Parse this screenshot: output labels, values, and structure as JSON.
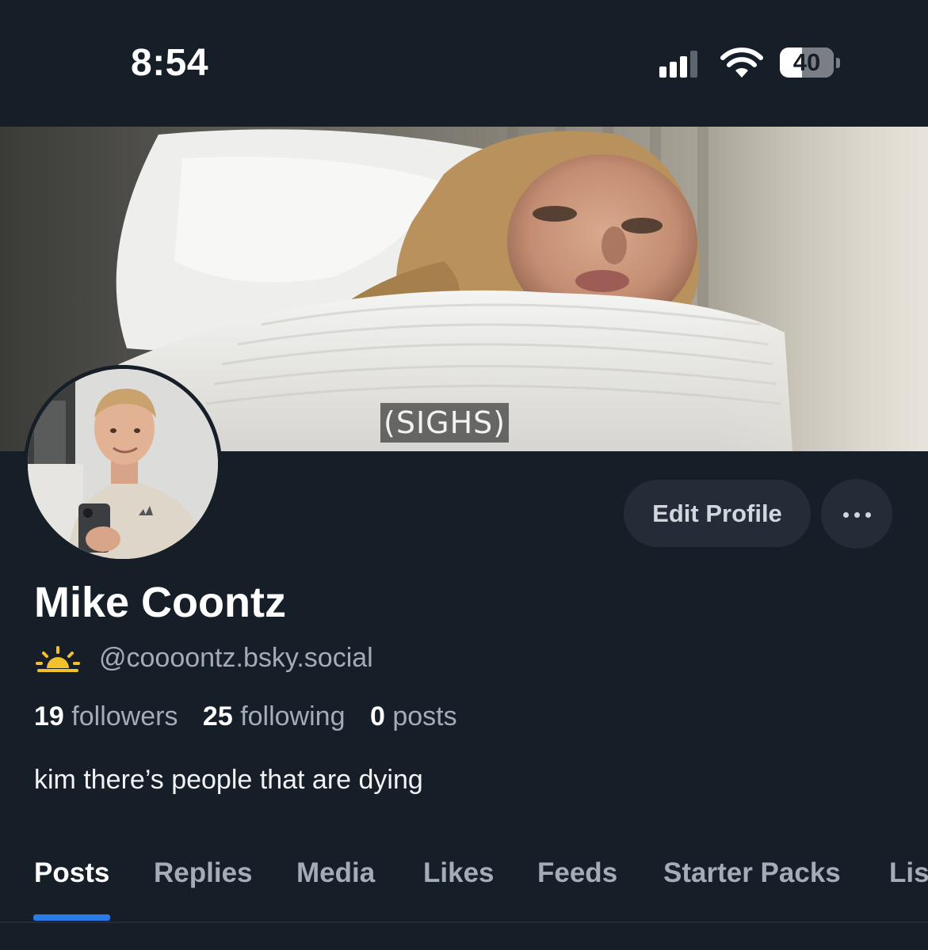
{
  "status_bar": {
    "time": "8:54",
    "battery_level": "40",
    "signal_bars_filled": 3,
    "signal_bars_total": 4
  },
  "banner": {
    "caption": "(SIGHS)"
  },
  "actions": {
    "edit_profile_label": "Edit Profile",
    "more_icon": "ellipsis-icon"
  },
  "profile": {
    "display_name": "Mike Coontz",
    "handle": "@coooontz.bsky.social",
    "handle_icon": "sunrise-icon",
    "bio": "kim there’s people that are dying"
  },
  "stats": [
    {
      "value": "19",
      "label": "followers"
    },
    {
      "value": "25",
      "label": "following"
    },
    {
      "value": "0",
      "label": "posts"
    }
  ],
  "tabs": [
    {
      "label": "Posts",
      "active": true
    },
    {
      "label": "Replies",
      "active": false
    },
    {
      "label": "Media",
      "active": false
    },
    {
      "label": "Likes",
      "active": false
    },
    {
      "label": "Feeds",
      "active": false
    },
    {
      "label": "Starter Packs",
      "active": false
    },
    {
      "label": "Lis",
      "active": false
    }
  ],
  "colors": {
    "background": "#161e27",
    "button_bg": "#242c37",
    "muted_text": "#a3acb7",
    "accent": "#2a7ae8",
    "sun_icon": "#f2c12e"
  }
}
